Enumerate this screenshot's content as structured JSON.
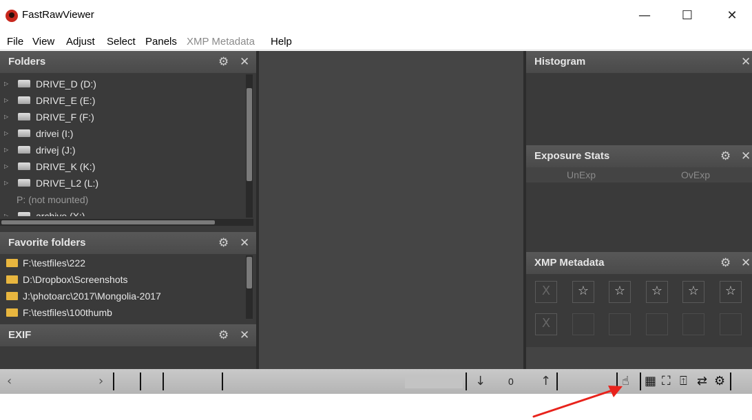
{
  "window": {
    "title": "FastRawViewer",
    "controls": {
      "minimize": "—",
      "maximize": "☐",
      "close": "✕"
    }
  },
  "menu": [
    "File",
    "View",
    "Adjust",
    "Select",
    "Panels",
    "XMP Metadata",
    "Help"
  ],
  "panels": {
    "folders": {
      "title": "Folders",
      "items": [
        {
          "label": "DRIVE_D (D:)"
        },
        {
          "label": "DRIVE_E (E:)"
        },
        {
          "label": "DRIVE_F (F:)"
        },
        {
          "label": "drivei (I:)"
        },
        {
          "label": "drivej (J:)"
        },
        {
          "label": "DRIVE_K (K:)"
        },
        {
          "label": "DRIVE_L2 (L:)"
        },
        {
          "label": "P: (not mounted)"
        },
        {
          "label": "archive (X:)"
        }
      ]
    },
    "favorites": {
      "title": "Favorite folders",
      "items": [
        "F:\\testfiles\\222",
        "D:\\Dropbox\\Screenshots",
        "J:\\photoarc\\2017\\Mongolia-2017",
        "F:\\testfiles\\100thumb"
      ]
    },
    "exif": {
      "title": "EXIF"
    },
    "histogram": {
      "title": "Histogram"
    },
    "exposure": {
      "title": "Exposure Stats",
      "col1": "UnExp",
      "col2": "OvExp"
    },
    "xmp": {
      "title": "XMP Metadata",
      "reject": "X",
      "star": "☆"
    }
  },
  "statusbar": {
    "counter": "0",
    "down_arrow": "↓",
    "up_arrow": "↑"
  },
  "icons": {
    "gear": "gear-icon",
    "close": "close-icon",
    "hand": "hand-tool-icon",
    "grid": "grid-view-icon"
  },
  "colors": {
    "accent_red": "#e8231c",
    "panel_bg": "#3c3c3c",
    "folder": "#e8b63f"
  }
}
